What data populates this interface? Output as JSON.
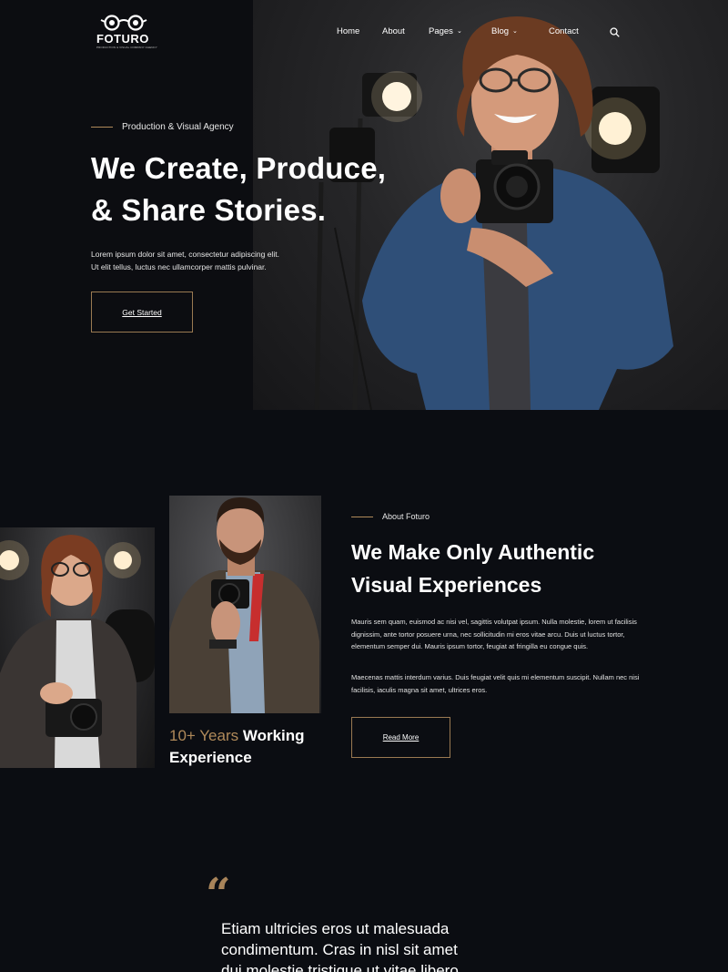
{
  "brand": {
    "name": "FOTURO",
    "tagline": "PRODUCTION & VISUAL COMPANY AGENCY"
  },
  "nav": {
    "items": [
      {
        "label": "Home"
      },
      {
        "label": "About"
      },
      {
        "label": "Pages",
        "dropdown": true
      },
      {
        "label": "Blog",
        "dropdown": true
      },
      {
        "label": "Contact"
      }
    ],
    "search_icon": "search-icon"
  },
  "hero": {
    "eyebrow": "Production & Visual Agency",
    "title_line1": "We Create, Produce,",
    "title_line2": "& Share Stories.",
    "desc_line1": "Lorem ipsum dolor sit amet, consectetur adipiscing elit.",
    "desc_line2": "Ut elit tellus, luctus nec ullamcorper mattis pulvinar.",
    "cta": "Get Started"
  },
  "about": {
    "eyebrow": "About Foturo",
    "title_line1": "We Make Only Authentic",
    "title_line2": "Visual Experiences",
    "para1": "Mauris sem quam, euismod ac nisi vel, sagittis volutpat ipsum. Nulla molestie, lorem ut facilisis dignissim, ante tortor posuere urna, nec sollicitudin mi eros vitae arcu. Duis ut luctus tortor, elementum semper dui. Mauris ipsum tortor, feugiat at fringilla eu congue quis.",
    "para2": "Maecenas mattis interdum varius. Duis feugiat velit quis mi elementum suscipit. Nullam nec nisi facilisis, iaculis magna sit amet, ultrices eros.",
    "years_accent": "10+ Years",
    "years_rest": "Working",
    "years_line2": "Experience",
    "cta": "Read More"
  },
  "quote": {
    "mark": "“",
    "line1": "Etiam ultricies eros ut malesuada",
    "line2": "condimentum. Cras in nisl sit amet",
    "line3": "dui molestie tristique ut vitae libero"
  },
  "colors": {
    "background": "#0b0d12",
    "accent": "#b08a5a",
    "text": "#ffffff"
  }
}
